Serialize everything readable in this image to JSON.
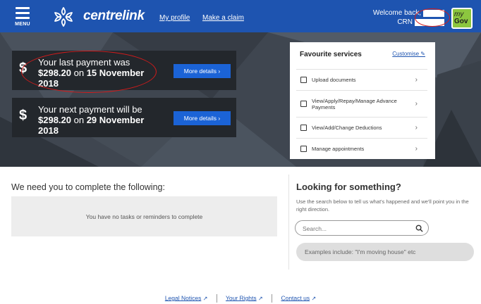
{
  "header": {
    "menu_label": "MENU",
    "logo_text": "centrelink",
    "nav": {
      "my_profile": "My profile",
      "make_claim": "Make a claim"
    },
    "welcome_text": "Welcome back,",
    "crn_label": "CRN",
    "mygov_badge": {
      "line1": "my",
      "line2": "Gov"
    }
  },
  "payments": {
    "last": {
      "line1": "Your last payment was",
      "amount": "$298.20",
      "on": " on ",
      "date_part": "15 November",
      "year": "2018",
      "button": "More details ›"
    },
    "next": {
      "line1": "Your next payment will be",
      "amount": "$298.20",
      "on": " on ",
      "date_part": "29 November",
      "year": "2018",
      "button": "More details ›"
    },
    "currency_symbol": "$"
  },
  "favourites": {
    "title": "Favourite services",
    "customise": "Customise ✎",
    "items": [
      {
        "label": "Upload documents",
        "icon": "upload-icon"
      },
      {
        "label": "View/Apply/Repay/Manage Advance Payments",
        "icon": "advance-payment-icon"
      },
      {
        "label": "View/Add/Change Deductions",
        "icon": "calendar-icon"
      },
      {
        "label": "Manage appointments",
        "icon": "calendar-check-icon"
      }
    ],
    "chevron": "›"
  },
  "tasks": {
    "heading": "We need you to complete the following:",
    "empty_message": "You have no tasks or reminders to complete"
  },
  "looking": {
    "heading": "Looking for something?",
    "description": "Use the search below to tell us what's happened and we'll point you in the right direction.",
    "search_placeholder": "Search...",
    "examples": "Examples include: \"I'm moving house\" etc"
  },
  "footer": {
    "links": [
      "Legal Notices",
      "Your Rights",
      "Contact us"
    ],
    "external_icon": "↗"
  },
  "colors": {
    "header_blue": "#1e54b0",
    "button_blue": "#1b63d6",
    "card_dark": "#23272c",
    "mygov_green": "#8cc63f",
    "annotation_red": "#d31b1b"
  }
}
